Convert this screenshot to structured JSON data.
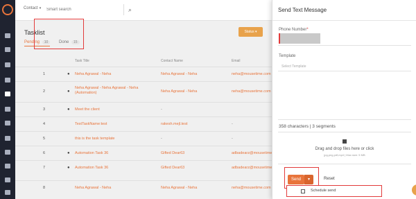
{
  "topbar": {
    "contact_select": "Contact",
    "search_placeholder": "Smart search"
  },
  "tasklist": {
    "title": "Tasklist",
    "tabs": [
      {
        "label": "Pending",
        "count": "10"
      },
      {
        "label": "Done",
        "count": "15"
      }
    ],
    "status_button": "Status"
  },
  "table": {
    "headers": [
      "Task Title",
      "Contact Name",
      "Email"
    ],
    "rows": [
      {
        "num": "1",
        "title": "Neha Agrawal - Neha",
        "contact": "Neha Agrawal - Neha",
        "email": "neha@mousetime.com"
      },
      {
        "num": "2",
        "title": "Neha Agrawal - Neha Agrawal - Neha (Automation)",
        "contact": "Neha Agrawal - Neha",
        "email": "neha@mousetime.com"
      },
      {
        "num": "3",
        "title": "Meet the client",
        "contact": "-",
        "email": ""
      },
      {
        "num": "4",
        "title": "TestTaskName:test",
        "contact": "rakesh.mejl.test",
        "email": "-"
      },
      {
        "num": "5",
        "title": "this is the task template",
        "contact": "-",
        "email": "-"
      },
      {
        "num": "6",
        "title": "Automation Task 36",
        "contact": "Gifted Dear63",
        "email": "adbadearz@mousetime.com"
      },
      {
        "num": "7",
        "title": "Automation Task 36",
        "contact": "Gifted Dear63",
        "email": "adbadearz@mousetime.com"
      },
      {
        "num": "8",
        "title": "Neha Agrawal - Neha",
        "contact": "Neha Agrawal - Neha",
        "email": "neha@mousetime.com"
      }
    ]
  },
  "panel": {
    "title": "Send Text Message",
    "phone_label": "Phone Number",
    "template_label": "Template",
    "template_placeholder": "Select Template",
    "char_count": "358 characters | 3 segments",
    "upload_text": "Drag and drop files here or click",
    "upload_hint": "jpg,png,pdf,mp4 | Max size: 5 MB",
    "send_label": "Send",
    "reset_label": "Reset",
    "schedule_label": "Schedule send"
  },
  "colors": {
    "accent": "#e8743b",
    "highlight": "#e23a3a",
    "sidebar": "#1f2330"
  }
}
